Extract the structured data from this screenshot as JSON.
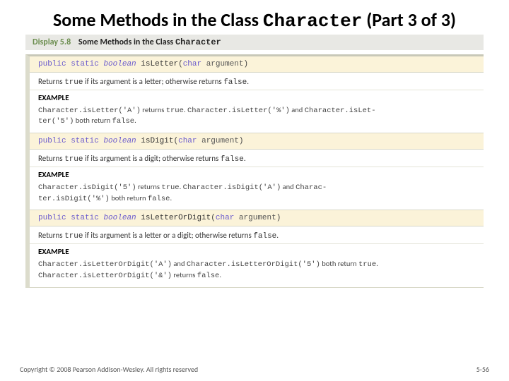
{
  "title_pre": "Some Methods in the Class ",
  "title_code": "Character",
  "title_post": " (Part 3 of 3)",
  "display_num": "Display 5.8",
  "display_title_pre": "Some Methods in the Class ",
  "display_title_code": "Character",
  "methods": [
    {
      "sig_mod": "public static",
      "sig_type": "boolean",
      "sig_name": "isLetter",
      "sig_ptype": "char",
      "sig_pname": "argument",
      "desc_pre": "Returns ",
      "desc_c1": "true",
      "desc_mid": " if its argument is a letter; otherwise returns ",
      "desc_c2": "false",
      "desc_post": ".",
      "ex_hdr": "EXAMPLE",
      "ex_l1a": "Character.isLetter('A')",
      "ex_l1b": " returns ",
      "ex_l1c": "true",
      "ex_l1d": ". ",
      "ex_l1e": "Character.isLetter('%')",
      "ex_l1f": " and ",
      "ex_l1g": "Character.isLet-",
      "ex_l2a": "ter('5')",
      "ex_l2b": " both return ",
      "ex_l2c": "false",
      "ex_l2d": "."
    },
    {
      "sig_mod": "public static",
      "sig_type": "boolean",
      "sig_name": "isDigit",
      "sig_ptype": "char",
      "sig_pname": "argument",
      "desc_pre": "Returns ",
      "desc_c1": "true",
      "desc_mid": " if its argument is a digit; otherwise returns ",
      "desc_c2": "false",
      "desc_post": ".",
      "ex_hdr": "EXAMPLE",
      "ex_l1a": "Character.isDigit('5')",
      "ex_l1b": " returns ",
      "ex_l1c": "true",
      "ex_l1d": ". ",
      "ex_l1e": "Character.isDigit('A')",
      "ex_l1f": " and ",
      "ex_l1g": "Charac-",
      "ex_l2a": "ter.isDigit('%')",
      "ex_l2b": " both return ",
      "ex_l2c": "false",
      "ex_l2d": "."
    },
    {
      "sig_mod": "public static",
      "sig_type": "boolean",
      "sig_name": "isLetterOrDigit",
      "sig_ptype": "char",
      "sig_pname": "argument",
      "desc_pre": "Returns ",
      "desc_c1": "true",
      "desc_mid": " if its argument is a letter or a digit; otherwise returns ",
      "desc_c2": "false",
      "desc_post": ".",
      "ex_hdr": "EXAMPLE",
      "ex_l1a": "Character.isLetterOrDigit('A')",
      "ex_l1b": " and ",
      "ex_l1c": "Character.isLetterOrDigit('5')",
      "ex_l1d": " both return ",
      "ex_l1e": "true",
      "ex_l1f": ".",
      "ex_l1g": "",
      "ex_l2a": "Character.isLetterOrDigit('&')",
      "ex_l2b": " returns ",
      "ex_l2c": "false",
      "ex_l2d": "."
    }
  ],
  "copyright": "Copyright © 2008 Pearson Addison-Wesley. All rights reserved",
  "pagenum": "5-56"
}
